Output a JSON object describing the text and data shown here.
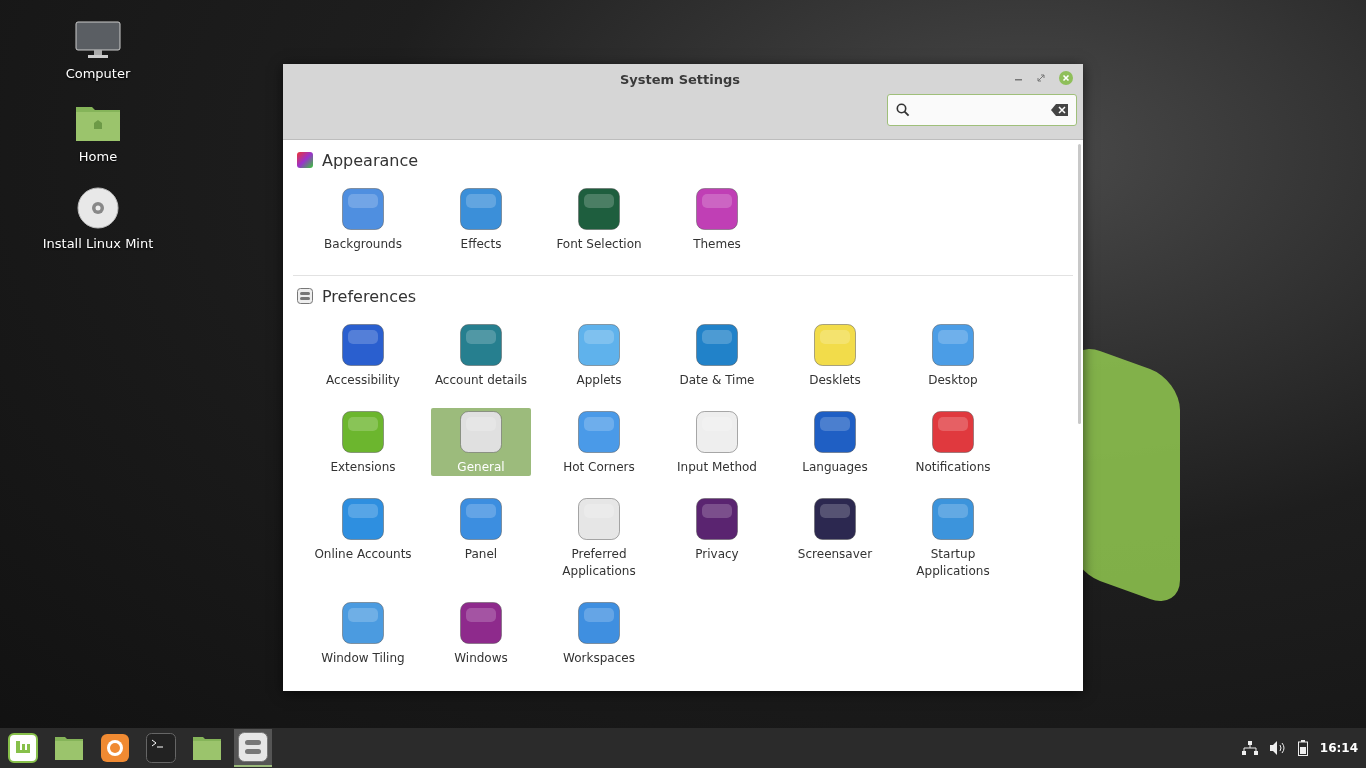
{
  "desktop_icons": [
    {
      "label": "Computer",
      "kind": "monitor"
    },
    {
      "label": "Home",
      "kind": "folder"
    },
    {
      "label": "Install Linux Mint",
      "kind": "disc"
    }
  ],
  "window": {
    "title": "System Settings"
  },
  "sections": [
    {
      "title": "Appearance",
      "kind": "palette",
      "items": [
        {
          "label": "Backgrounds",
          "color": "#4f8fe0",
          "selected": false
        },
        {
          "label": "Effects",
          "color": "#3b8fd9",
          "selected": false
        },
        {
          "label": "Font Selection",
          "color": "#1e5e3e",
          "selected": false
        },
        {
          "label": "Themes",
          "color": "#c03fb5",
          "selected": false
        }
      ]
    },
    {
      "title": "Preferences",
      "kind": "toggles",
      "items": [
        {
          "label": "Accessibility",
          "color": "#2a5fcf",
          "selected": false
        },
        {
          "label": "Account details",
          "color": "#267f8f",
          "selected": false
        },
        {
          "label": "Applets",
          "color": "#5fb2ec",
          "selected": false
        },
        {
          "label": "Date & Time",
          "color": "#2182c9",
          "selected": false
        },
        {
          "label": "Desklets",
          "color": "#f2dc4a",
          "selected": false
        },
        {
          "label": "Desktop",
          "color": "#4b9de6",
          "selected": false
        },
        {
          "label": "Extensions",
          "color": "#6cb62e",
          "selected": false
        },
        {
          "label": "General",
          "color": "#e0e0e0",
          "selected": true
        },
        {
          "label": "Hot Corners",
          "color": "#4a9ae8",
          "selected": false
        },
        {
          "label": "Input Method",
          "color": "#eeeeee",
          "selected": false
        },
        {
          "label": "Languages",
          "color": "#1f5fc4",
          "selected": false
        },
        {
          "label": "Notifications",
          "color": "#e0393e",
          "selected": false
        },
        {
          "label": "Online Accounts",
          "color": "#2e8fe0",
          "selected": false
        },
        {
          "label": "Panel",
          "color": "#3c8ee0",
          "selected": false
        },
        {
          "label": "Preferred Applications",
          "color": "#e6e6e6",
          "selected": false
        },
        {
          "label": "Privacy",
          "color": "#5a2470",
          "selected": false
        },
        {
          "label": "Screensaver",
          "color": "#2c2850",
          "selected": false
        },
        {
          "label": "Startup Applications",
          "color": "#3c94dc",
          "selected": false
        },
        {
          "label": "Window Tiling",
          "color": "#4b9be0",
          "selected": false
        },
        {
          "label": "Windows",
          "color": "#8e2a8c",
          "selected": false
        },
        {
          "label": "Workspaces",
          "color": "#3f8fe0",
          "selected": false
        }
      ]
    }
  ],
  "taskbar": {
    "launchers": [
      {
        "kind": "mint-menu",
        "selected": false
      },
      {
        "kind": "folder",
        "selected": false
      },
      {
        "kind": "browser",
        "selected": false
      },
      {
        "kind": "terminal",
        "selected": false
      },
      {
        "kind": "folder",
        "selected": false
      },
      {
        "kind": "settings",
        "selected": true
      }
    ],
    "clock": "16:14"
  }
}
